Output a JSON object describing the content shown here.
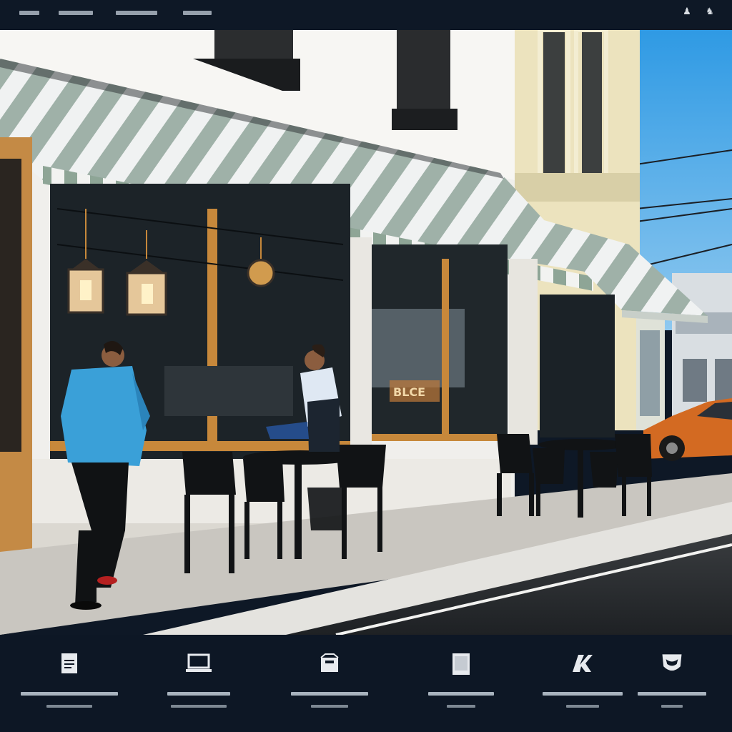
{
  "topbar": {
    "menu": [
      "",
      "",
      "",
      ""
    ],
    "icons": [
      "figure-icon",
      "figure-icon"
    ]
  },
  "scene": {
    "description_icons": [
      "awning",
      "lantern",
      "chair",
      "table",
      "car"
    ],
    "sign_text": "BLCE"
  },
  "dock": {
    "items": [
      {
        "icon": "document-icon",
        "label": "",
        "sub": ""
      },
      {
        "icon": "laptop-icon",
        "label": "",
        "sub": ""
      },
      {
        "icon": "inbox-icon",
        "label": "",
        "sub": ""
      },
      {
        "icon": "tablet-icon",
        "label": "",
        "sub": ""
      },
      {
        "icon": "logo-icon",
        "label": "",
        "sub": ""
      },
      {
        "icon": "mask-icon",
        "label": "",
        "sub": ""
      }
    ]
  },
  "colors": {
    "chrome": "#0e1826",
    "sky": "#3aa2e6",
    "awning_stripe": "#8fa59a",
    "shirt": "#3aa0d8",
    "car": "#d36a22"
  }
}
